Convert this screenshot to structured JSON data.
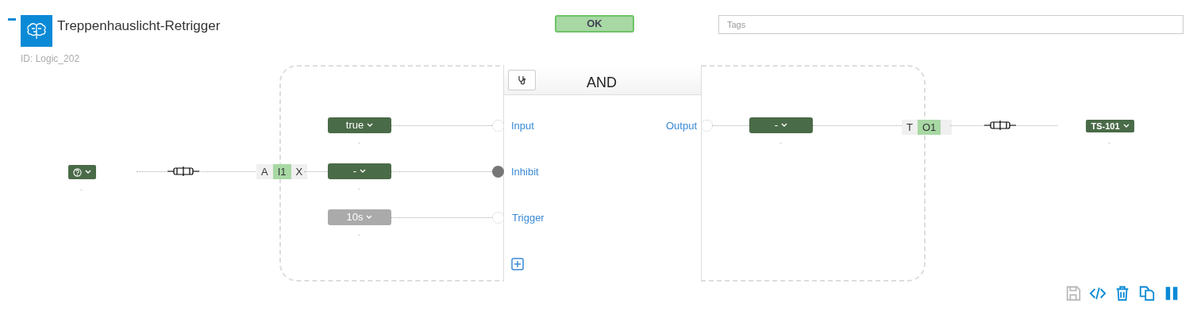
{
  "header": {
    "title": "Treppenhauslicht-Retrigger",
    "id_label": "ID: Logic_202",
    "status": "OK",
    "tags": {
      "placeholder": "Tags"
    }
  },
  "source": {
    "caption": "-"
  },
  "input_port": {
    "segments": [
      {
        "label": "A",
        "selected": false
      },
      {
        "label": "I1",
        "selected": true
      },
      {
        "label": "X",
        "selected": false
      }
    ]
  },
  "inputs": [
    {
      "value": "true",
      "kind": "set",
      "caption": "-",
      "label": "Input",
      "connected": false
    },
    {
      "value": "-",
      "kind": "set",
      "caption": "-",
      "label": "Inhibit",
      "connected": true
    },
    {
      "value": "10s",
      "kind": "default",
      "caption": "-",
      "label": "Trigger",
      "connected": false
    }
  ],
  "block": {
    "title": "AND"
  },
  "outputs": [
    {
      "label": "Output",
      "connected": false,
      "value": "-",
      "caption": "-"
    }
  ],
  "output_port": {
    "segments": [
      {
        "label": "T",
        "selected": false
      },
      {
        "label": "O1",
        "selected": true
      }
    ]
  },
  "target": {
    "value": "TS-101",
    "caption": "-"
  },
  "toolbar": [
    {
      "kind": "save",
      "disabled": true
    },
    {
      "kind": "code",
      "disabled": false
    },
    {
      "kind": "delete",
      "disabled": false
    },
    {
      "kind": "copy",
      "disabled": false
    },
    {
      "kind": "pause",
      "disabled": false
    }
  ]
}
